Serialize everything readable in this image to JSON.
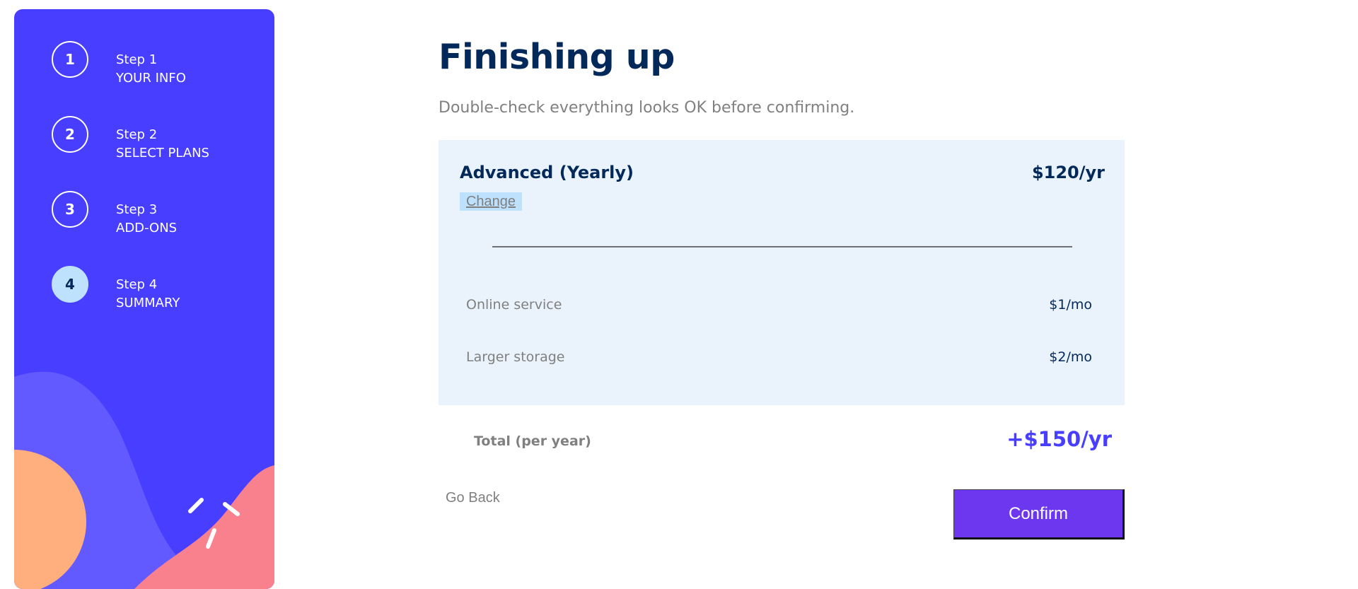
{
  "sidebar": {
    "steps": [
      {
        "number": "1",
        "title": "Step 1",
        "name": "YOUR INFO",
        "active": false
      },
      {
        "number": "2",
        "title": "Step 2",
        "name": "SELECT PLANS",
        "active": false
      },
      {
        "number": "3",
        "title": "Step 3",
        "name": "ADD-ONS",
        "active": false
      },
      {
        "number": "4",
        "title": "Step 4",
        "name": "SUMMARY",
        "active": true
      }
    ]
  },
  "main": {
    "title": "Finishing up",
    "subtitle": "Double-check everything looks OK before confirming."
  },
  "summary": {
    "plan_name": "Advanced (Yearly)",
    "plan_price": "$120/yr",
    "change_label": "Change",
    "addons": [
      {
        "name": "Online service",
        "price": "$1/mo"
      },
      {
        "name": "Larger storage",
        "price": "$2/mo"
      }
    ],
    "total_label": "Total (per year)",
    "total_price": "+$150/yr"
  },
  "actions": {
    "go_back_label": "Go Back",
    "confirm_label": "Confirm"
  },
  "colors": {
    "sidebar_bg": "#483eff",
    "marine_blue": "#022959",
    "purple": "#483eff",
    "light_blue": "#bee2fd",
    "box_bg": "#eaf2fc",
    "confirm_bg": "#6d36ef",
    "orange": "#ffaf7e",
    "pink": "#f9818e",
    "violet_wave": "#6259ff"
  }
}
